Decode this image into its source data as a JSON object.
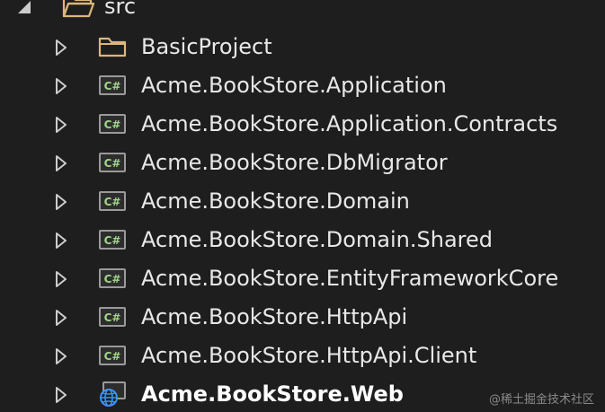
{
  "root": {
    "label": "src",
    "expanded": true,
    "icon": "folder-open-icon"
  },
  "items": [
    {
      "label": "BasicProject",
      "icon": "folder-icon",
      "bold": false
    },
    {
      "label": "Acme.BookStore.Application",
      "icon": "csharp-project-icon",
      "bold": false
    },
    {
      "label": "Acme.BookStore.Application.Contracts",
      "icon": "csharp-project-icon",
      "bold": false
    },
    {
      "label": "Acme.BookStore.DbMigrator",
      "icon": "csharp-project-icon",
      "bold": false
    },
    {
      "label": "Acme.BookStore.Domain",
      "icon": "csharp-project-icon",
      "bold": false
    },
    {
      "label": "Acme.BookStore.Domain.Shared",
      "icon": "csharp-project-icon",
      "bold": false
    },
    {
      "label": "Acme.BookStore.EntityFrameworkCore",
      "icon": "csharp-project-icon",
      "bold": false
    },
    {
      "label": "Acme.BookStore.HttpApi",
      "icon": "csharp-project-icon",
      "bold": false
    },
    {
      "label": "Acme.BookStore.HttpApi.Client",
      "icon": "csharp-project-icon",
      "bold": false
    },
    {
      "label": "Acme.BookStore.Web",
      "icon": "web-project-icon",
      "bold": true
    }
  ],
  "icon_text": {
    "csharp": "C#"
  },
  "watermark": "@稀土掘金技术社区",
  "colors": {
    "background": "#1e1e1e",
    "text": "#e8e8e8",
    "folder": "#dcb67a",
    "csharp_green": "#a1d68b",
    "csharp_frame": "#9a9a9a",
    "globe_blue": "#3794ff",
    "expander": "#cccccc"
  }
}
